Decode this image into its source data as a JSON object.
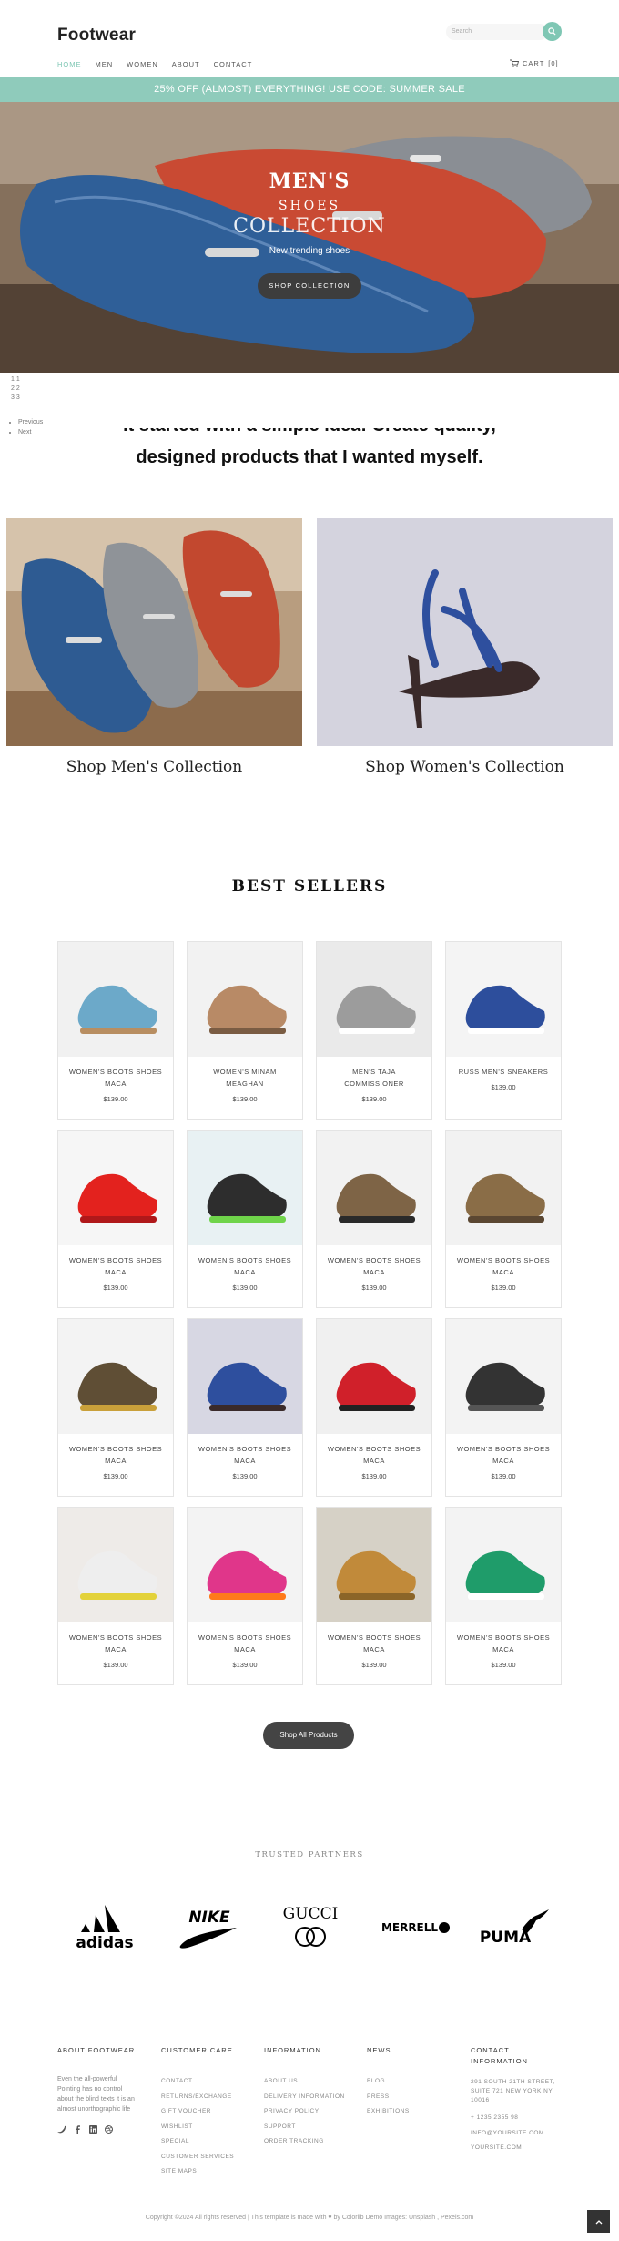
{
  "header": {
    "logo": "Footwear",
    "search_placeholder": "Search",
    "accent": "#7fc7b4"
  },
  "nav": [
    {
      "label": "HOME",
      "active": true
    },
    {
      "label": "MEN"
    },
    {
      "label": "WOMEN"
    },
    {
      "label": "ABOUT"
    },
    {
      "label": "CONTACT"
    }
  ],
  "cart": {
    "label": "CART",
    "count": "[0]"
  },
  "promo": "25% OFF (ALMOST) EVERYTHING! USE CODE: SUMMER SALE",
  "hero": {
    "line1": "MEN'S",
    "line2": "SHOES",
    "line3": "COLLECTION",
    "sub": "New trending shoes",
    "button": "SHOP COLLECTION"
  },
  "slider": {
    "pages": [
      "1 1",
      "2 2",
      "3 3"
    ],
    "prev": "Previous",
    "next": "Next"
  },
  "tagline": {
    "line1": "It started with a simple idea: Create quality,",
    "line2": "designed products that I wanted myself."
  },
  "collections": {
    "men": "Shop Men's Collection",
    "women": "Shop Women's Collection"
  },
  "best_sellers": {
    "title": "BEST SELLERS",
    "products": [
      {
        "name": "WOMEN'S BOOTS SHOES MACA",
        "price": "$139.00",
        "icon": "boot-icon"
      },
      {
        "name": "WOMEN'S MINAM MEAGHAN",
        "price": "$139.00",
        "icon": "pump-heel-icon"
      },
      {
        "name": "MEN'S TAJA COMMISSIONER",
        "price": "$139.00",
        "icon": "sneaker-icon"
      },
      {
        "name": "RUSS MEN'S SNEAKERS",
        "price": "$139.00",
        "icon": "running-shoe-icon"
      },
      {
        "name": "WOMEN'S BOOTS SHOES MACA",
        "price": "$139.00",
        "icon": "red-heels-icon"
      },
      {
        "name": "WOMEN'S BOOTS SHOES MACA",
        "price": "$139.00",
        "icon": "sport-shoe-icon"
      },
      {
        "name": "WOMEN'S BOOTS SHOES MACA",
        "price": "$139.00",
        "icon": "brown-shoe-icon"
      },
      {
        "name": "WOMEN'S BOOTS SHOES MACA",
        "price": "$139.00",
        "icon": "brown-loafer-icon"
      },
      {
        "name": "WOMEN'S BOOTS SHOES MACA",
        "price": "$139.00",
        "icon": "hiking-shoe-icon"
      },
      {
        "name": "WOMEN'S BOOTS SHOES MACA",
        "price": "$139.00",
        "icon": "strappy-heel-icon"
      },
      {
        "name": "WOMEN'S BOOTS SHOES MACA",
        "price": "$139.00",
        "icon": "jordan-sneaker-icon"
      },
      {
        "name": "WOMEN'S BOOTS SHOES MACA",
        "price": "$139.00",
        "icon": "black-runner-icon"
      },
      {
        "name": "WOMEN'S BOOTS SHOES MACA",
        "price": "$139.00",
        "icon": "white-sneaker-icon"
      },
      {
        "name": "WOMEN'S BOOTS SHOES MACA",
        "price": "$139.00",
        "icon": "pink-runner-icon"
      },
      {
        "name": "WOMEN'S BOOTS SHOES MACA",
        "price": "$139.00",
        "icon": "tan-sneaker-icon"
      },
      {
        "name": "WOMEN'S BOOTS SHOES MACA",
        "price": "$139.00",
        "icon": "green-sneaker-icon"
      }
    ],
    "shop_all": "Shop All Products"
  },
  "partners": {
    "title": "TRUSTED PARTNERS",
    "brands": [
      "adidas",
      "NIKE",
      "GUCCI",
      "MERRELL",
      "PUMA"
    ]
  },
  "footer": {
    "about": {
      "title": "ABOUT FOOTWEAR",
      "text": "Even the all-powerful Pointing has no control about the blind texts it is an almost unorthographic life"
    },
    "care": {
      "title": "CUSTOMER CARE",
      "links": [
        "CONTACT",
        "RETURNS/EXCHANGE",
        "GIFT VOUCHER",
        "WISHLIST",
        "SPECIAL",
        "CUSTOMER SERVICES",
        "SITE MAPS"
      ]
    },
    "info": {
      "title": "INFORMATION",
      "links": [
        "ABOUT US",
        "DELIVERY INFORMATION",
        "PRIVACY POLICY",
        "SUPPORT",
        "ORDER TRACKING"
      ]
    },
    "news": {
      "title": "NEWS",
      "links": [
        "BLOG",
        "PRESS",
        "EXHIBITIONS"
      ]
    },
    "contact": {
      "title": "CONTACT INFORMATION",
      "address1": "291 SOUTH 21TH STREET,",
      "address2": "SUITE 721 NEW YORK NY 10016",
      "phone": "+ 1235 2355 98",
      "email": "INFO@YOURSITE.COM",
      "site": "YOURSITE.COM"
    },
    "copyright": "Copyright ©2024 All rights reserved | This template is made with ♥ by Colorlib Demo Images: Unsplash , Pexels.com"
  }
}
